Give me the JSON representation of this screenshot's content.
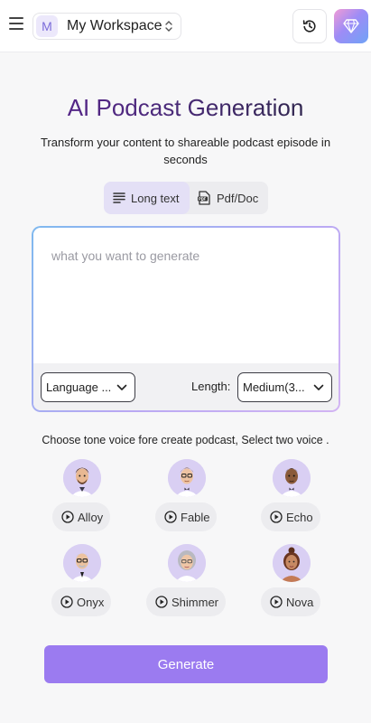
{
  "header": {
    "menu_icon": "hamburger-menu-icon",
    "workspace_initial": "M",
    "workspace_name": "My Workspace",
    "history_icon": "history-icon",
    "premium_icon": "diamond-icon"
  },
  "hero": {
    "title": "AI Podcast Generation",
    "subtitle": "Transform your content to shareable podcast episode in seconds"
  },
  "tabs": [
    {
      "label": "Long text",
      "icon": "text-lines-icon",
      "selected": true
    },
    {
      "label": "Pdf/Doc",
      "icon": "pdf-icon",
      "selected": false
    }
  ],
  "editor": {
    "placeholder": "what you want to generate",
    "value": "",
    "language_select": "Language ...",
    "length_label": "Length:",
    "length_select": "Medium(3..."
  },
  "voices": {
    "heading": "Choose tone voice fore create podcast, Select two voice .",
    "items": [
      {
        "name": "Alloy"
      },
      {
        "name": "Fable"
      },
      {
        "name": "Echo"
      },
      {
        "name": "Onyx"
      },
      {
        "name": "Shimmer"
      },
      {
        "name": "Nova"
      }
    ]
  },
  "actions": {
    "generate_label": "Generate"
  },
  "colors": {
    "accent": "#9b7bf0",
    "title_start": "#5b2390",
    "title_end": "#23233a"
  }
}
